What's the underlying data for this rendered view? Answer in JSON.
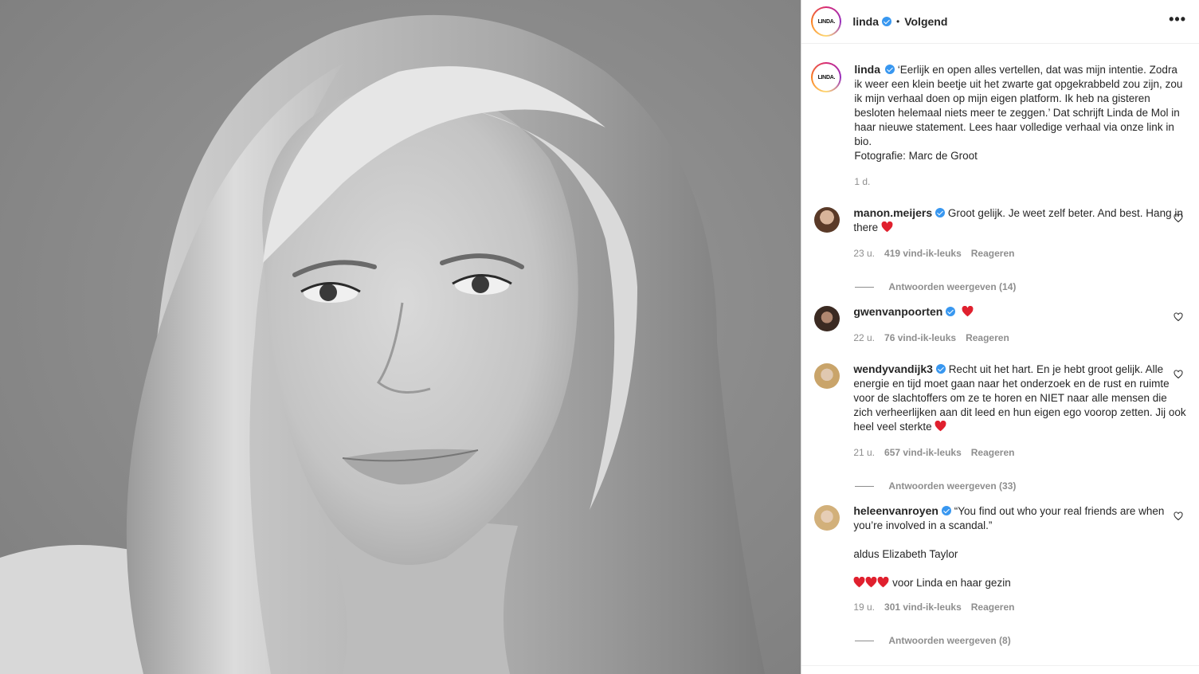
{
  "post": {
    "username": "linda",
    "avatar_text": "LINDA.",
    "follow_label": "Volgend",
    "more_icon": "•••",
    "caption": "‘Eerlijk en open alles vertellen, dat was mijn intentie. Zodra ik weer een klein beetje uit het zwarte gat opgekrabbeld zou zijn, zou ik mijn verhaal doen op mijn eigen platform. Ik heb na gisteren besloten helemaal niets meer te zeggen.’ Dat schrijft Linda de Mol in haar nieuwe statement. Lees haar volledige verhaal via onze link in bio.",
    "credit": "Fotografie: Marc de Groot",
    "time": "1 d."
  },
  "comments": [
    {
      "username": "manon.meijers",
      "text": "Groot gelijk. Je weet zelf beter. And best. Hang in there",
      "time": "23 u.",
      "likes": "419 vind-ik-leuks",
      "reply_label": "Reageren",
      "replies": "Antwoorden weergeven (14)"
    },
    {
      "username": "gwenvanpoorten",
      "text": "",
      "time": "22 u.",
      "likes": "76 vind-ik-leuks",
      "reply_label": "Reageren"
    },
    {
      "username": "wendyvandijk3",
      "text": "Recht uit het hart. En je hebt groot gelijk. Alle energie en tijd moet gaan naar het onderzoek en de rust en ruimte voor de slachtoffers om ze te horen en NIET naar alle mensen die zich verheerlijken aan dit leed en hun eigen ego voorop zetten. Jij ook heel veel sterkte",
      "time": "21 u.",
      "likes": "657 vind-ik-leuks",
      "reply_label": "Reageren",
      "replies": "Antwoorden weergeven (33)"
    },
    {
      "username": "heleenvanroyen",
      "text": "“You find out who your real friends are when you’re involved in a scandal.”",
      "text2": "aldus Elizabeth Taylor",
      "text3": "voor Linda en haar gezin",
      "time": "19 u.",
      "likes": "301 vind-ik-leuks",
      "reply_label": "Reageren",
      "replies": "Antwoorden weergeven (8)"
    }
  ],
  "colors": {
    "verified": "#3897f0",
    "heart": "#ed4956",
    "meta": "#8e8e8e"
  }
}
